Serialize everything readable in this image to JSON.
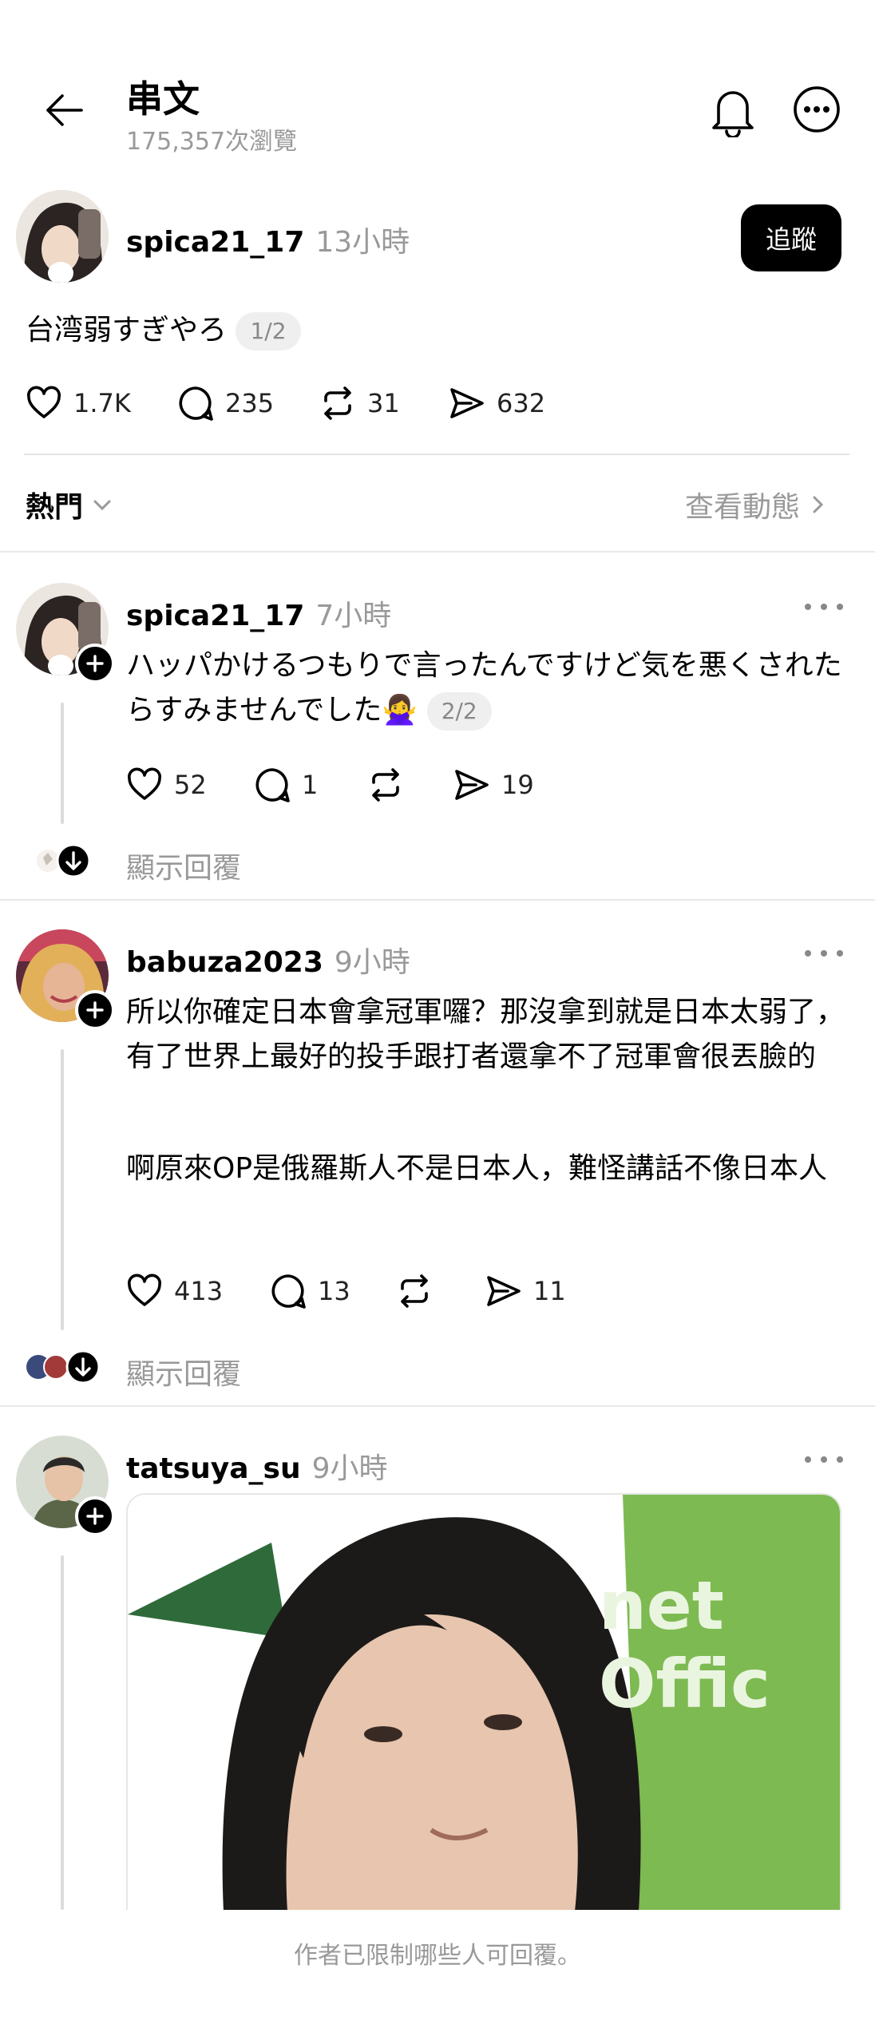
{
  "header": {
    "title": "串文",
    "subtitle": "175,357次瀏覽"
  },
  "main_post": {
    "username": "spica21_17",
    "time": "13小時",
    "follow_label": "追蹤",
    "text": "台湾弱すぎやろ",
    "page": "1/2",
    "likes": "1.7K",
    "comments": "235",
    "reposts": "31",
    "shares": "632"
  },
  "sort": {
    "label": "熱門",
    "activity_link": "查看動態"
  },
  "replies": [
    {
      "username": "spica21_17",
      "time": "7小時",
      "text": "ハッパかけるつもりで言ったんですけど気を悪くされたらすみませんでした🙅‍♀️",
      "page": "2/2",
      "likes": "52",
      "comments": "1",
      "shares": "19",
      "show_replies": "顯示回覆"
    },
    {
      "username": "babuza2023",
      "time": "9小時",
      "text1": "所以你確定日本會拿冠軍囉？那沒拿到就是日本太弱了，有了世界上最好的投手跟打者還拿不了冠軍會很丟臉的",
      "text2": "啊原來OP是俄羅斯人不是日本人，難怪講話不像日本人",
      "likes": "413",
      "comments": "13",
      "shares": "11",
      "show_replies": "顯示回覆"
    },
    {
      "username": "tatsuya_su",
      "time": "9小時",
      "image_sign_text": "net Offic"
    }
  ],
  "footer": {
    "notice": "作者已限制哪些人可回覆。"
  },
  "icons": {
    "back": "back-arrow-icon",
    "bell": "bell-icon",
    "more": "more-circle-icon",
    "like": "heart-icon",
    "comment": "comment-icon",
    "repost": "repost-icon",
    "share": "send-icon"
  }
}
